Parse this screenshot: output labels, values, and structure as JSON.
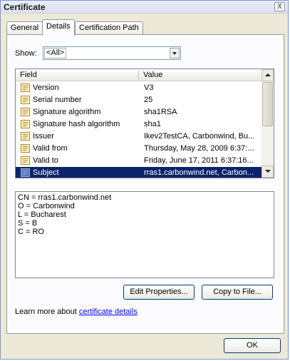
{
  "window": {
    "title": "Certificate",
    "close_glyph": "X"
  },
  "tabs": [
    {
      "label": "General",
      "active": false
    },
    {
      "label": "Details",
      "active": true
    },
    {
      "label": "Certification Path",
      "active": false
    }
  ],
  "show": {
    "label": "Show:",
    "value": "<All>"
  },
  "list": {
    "columns": [
      "Field",
      "Value"
    ],
    "rows": [
      {
        "field": "Version",
        "value": "V3",
        "icon": "certificate-field-icon",
        "selected": false
      },
      {
        "field": "Serial number",
        "value": "25",
        "icon": "certificate-field-icon",
        "selected": false
      },
      {
        "field": "Signature algorithm",
        "value": "sha1RSA",
        "icon": "certificate-field-icon",
        "selected": false
      },
      {
        "field": "Signature hash algorithm",
        "value": "sha1",
        "icon": "certificate-field-icon",
        "selected": false
      },
      {
        "field": "Issuer",
        "value": "Ikev2TestCA, Carbonwind, Bu...",
        "icon": "certificate-field-icon",
        "selected": false
      },
      {
        "field": "Valid from",
        "value": "Thursday, May 28, 2009 6:37:...",
        "icon": "certificate-field-icon",
        "selected": false
      },
      {
        "field": "Valid to",
        "value": "Friday, June 17, 2011 6:37:16...",
        "icon": "certificate-field-icon",
        "selected": false
      },
      {
        "field": "Subject",
        "value": "rras1.carbonwind.net, Carbon...",
        "icon": "certificate-field-icon",
        "selected": true
      }
    ]
  },
  "detail": {
    "lines": [
      "CN = rras1.carbonwind.net",
      "O = Carbonwind",
      "L = Bucharest",
      "S = B",
      "C = RO"
    ]
  },
  "buttons": {
    "edit_properties": "Edit Properties...",
    "copy_to_file": "Copy to File...",
    "ok": "OK"
  },
  "learn_more": {
    "prefix": "Learn more about ",
    "link": "certificate details"
  },
  "colors": {
    "selection": "#0a246a",
    "link": "#0000ee",
    "dialog_bg": "#ece9d8"
  }
}
